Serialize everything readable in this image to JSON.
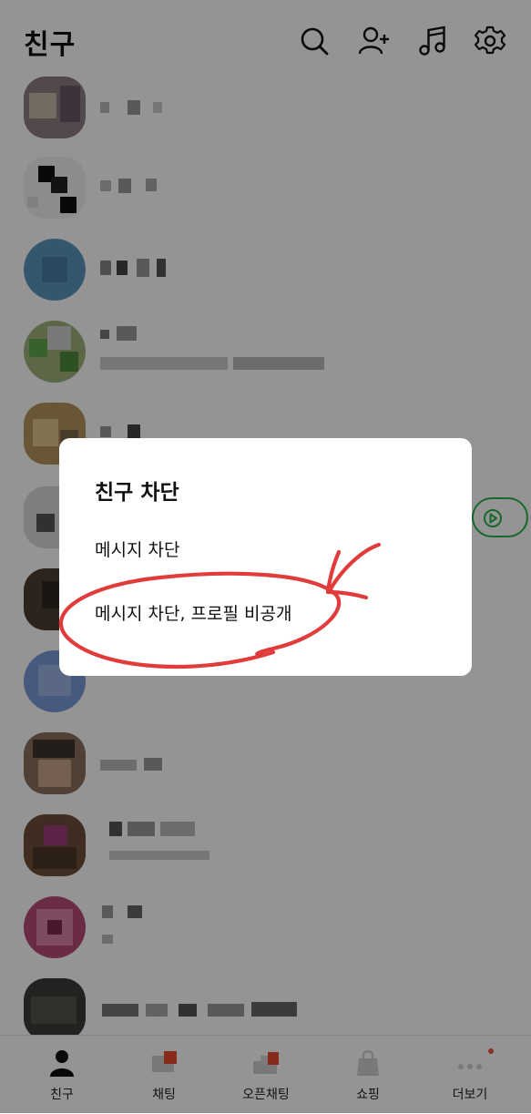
{
  "header": {
    "title": "친구",
    "icons": [
      "search-icon",
      "add-friend-icon",
      "music-icon",
      "settings-icon"
    ]
  },
  "dialog": {
    "title": "친구 차단",
    "options": [
      {
        "label": "메시지 차단"
      },
      {
        "label": "메시지 차단, 프로필 비공개"
      }
    ]
  },
  "bottom_nav": {
    "items": [
      {
        "label": "친구",
        "icon": "person-icon"
      },
      {
        "label": "채팅",
        "icon": "chat-icon"
      },
      {
        "label": "오픈채팅",
        "icon": "open-chat-icon"
      },
      {
        "label": "쇼핑",
        "icon": "shopping-bag-icon"
      },
      {
        "label": "더보기",
        "icon": "more-dots-icon"
      }
    ]
  },
  "colors": {
    "overlay": "#000000",
    "annotation_red": "#e23b3b",
    "play_chip_green": "#2ab34a",
    "badge": "#f0553c"
  }
}
